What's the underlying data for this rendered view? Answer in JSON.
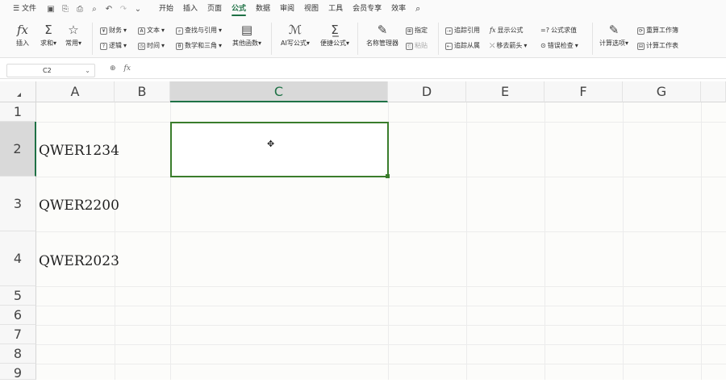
{
  "menubar": {
    "file_label": "文件",
    "tabs": [
      "开始",
      "插入",
      "页面",
      "公式",
      "数据",
      "审阅",
      "视图",
      "工具",
      "会员专享",
      "效率"
    ],
    "active_tab": "公式"
  },
  "ribbon": {
    "insert_fn": "插入",
    "autosum": "求和",
    "common": "常用",
    "finance": "财务",
    "logic": "逻辑",
    "text": "文本",
    "datetime": "时间",
    "lookup": "查找与引用",
    "math": "数学和三角",
    "other_fn": "其他函数",
    "ai_formula": "AI写公式",
    "quick_formula": "便捷公式",
    "name_manager": "名称管理器",
    "paste_name": "指定",
    "paste": "粘贴",
    "trace_precedents": "追踪引用",
    "trace_dependents": "追踪从属",
    "show_formulas": "显示公式",
    "remove_arrows": "移去箭头",
    "evaluate": "公式求值",
    "error_check": "错误检查",
    "calc_options": "计算选项",
    "recalc_book": "重算工作簿",
    "calc_sheet": "计算工作表"
  },
  "formula_bar": {
    "name_box": "C2",
    "fx": "fx"
  },
  "sheet": {
    "columns": [
      "A",
      "B",
      "C",
      "D",
      "E",
      "F",
      "G"
    ],
    "rows": [
      "1",
      "2",
      "3",
      "4",
      "5",
      "6",
      "7",
      "8",
      "9"
    ],
    "cells": {
      "A2": "QWER1234",
      "A3": "QWER2200",
      "A4": "QWER2023"
    },
    "selected_cell": "C2"
  },
  "colors": {
    "accent": "#1e7145",
    "selection_border": "#3a7d2c"
  }
}
